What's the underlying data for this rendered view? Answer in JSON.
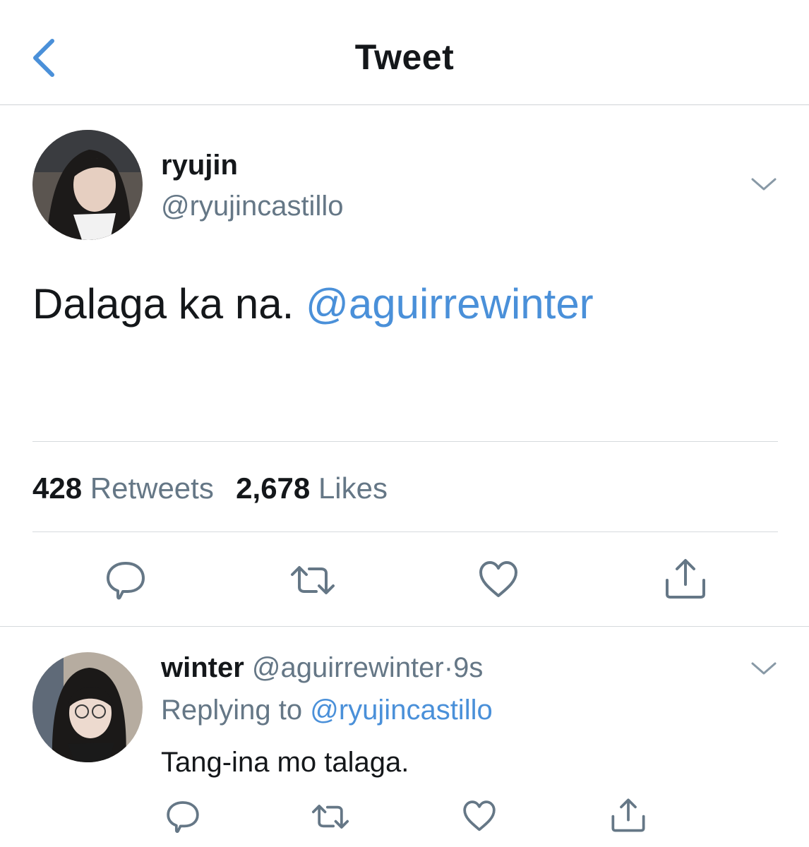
{
  "header": {
    "title": "Tweet"
  },
  "tweet": {
    "display_name": "ryujin",
    "handle": "@ryujincastillo",
    "text": "Dalaga ka na.",
    "mention": "@aguirrewinter",
    "stats": {
      "retweets_count": "428",
      "retweets_label": "Retweets",
      "likes_count": "2,678",
      "likes_label": "Likes"
    }
  },
  "reply": {
    "display_name": "winter",
    "handle": "@aguirrewinter",
    "separator": "·",
    "time": "9s",
    "replying_prefix": "Replying to",
    "replying_to": "@ryujincastillo",
    "text": "Tang-ina mo talaga."
  },
  "icons": {
    "back": "chevron-left-icon",
    "more": "chevron-down-icon",
    "reply": "speech-bubble-icon",
    "retweet": "retweet-arrows-icon",
    "like": "heart-icon",
    "share": "share-upload-icon"
  },
  "colors": {
    "link": "#4a90d9",
    "muted": "#657786",
    "icon": "#657786",
    "text": "#14171a"
  }
}
